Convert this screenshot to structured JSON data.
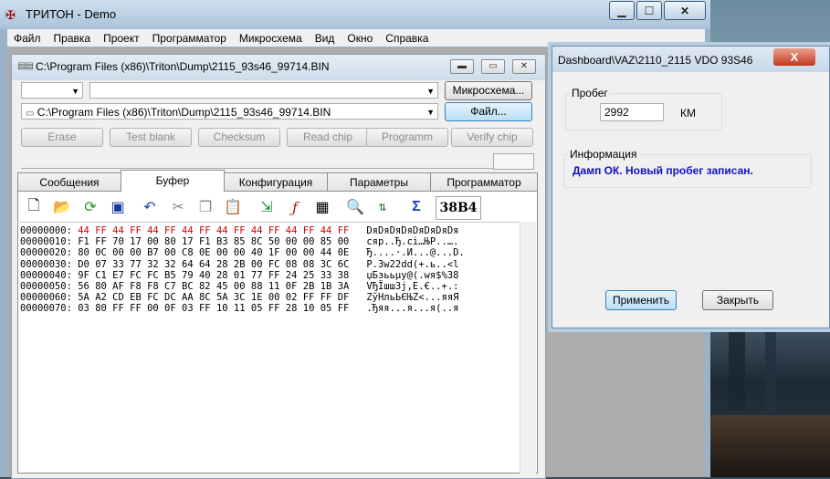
{
  "app": {
    "title": "ТРИТОН - Demo"
  },
  "menu": [
    "Файл",
    "Правка",
    "Проект",
    "Программатор",
    "Микросхема",
    "Вид",
    "Окно",
    "Справка"
  ],
  "child": {
    "title": "C:\\Program Files (x86)\\Triton\\Dump\\2115_93s46_99714.BIN",
    "combo_path": "C:\\Program Files (x86)\\Triton\\Dump\\2115_93s46_99714.BIN",
    "chip_button": "Микросхема...",
    "file_button": "Файл...",
    "actions": [
      "Erase",
      "Test blank",
      "Checksum",
      "Read chip",
      "Programm",
      "Verify chip"
    ],
    "tabs": [
      "Сообщения",
      "Буфер",
      "Конфигурация",
      "Параметры",
      "Программатор"
    ],
    "checksum": "38B4",
    "hex": [
      {
        "addr": "00000000:",
        "bytes": "44 FF 44 FF 44 FF 44 FF 44 FF 44 FF 44 FF 44 FF",
        "ascii": "DяDяDяDяDяDяDяDя",
        "red": true
      },
      {
        "addr": "00000010:",
        "bytes": "F1 FF 70 17 00 80 17 F1 B3 85 8C 50 00 00 85 00",
        "ascii": "сяp..Ђ.сі…ЊP..…."
      },
      {
        "addr": "00000020:",
        "bytes": "80 0C 00 00 B7 00 C8 0E 00 00 40 1F 00 00 44 0E",
        "ascii": "Ђ....·.И...@...D."
      },
      {
        "addr": "00000030:",
        "bytes": "D0 07 33 77 32 32 64 64 28 2B 00 FC 08 08 3C 6C",
        "ascii": "Р.3w22dd(+.ь..<l"
      },
      {
        "addr": "00000040:",
        "bytes": "9F C1 E7 FC FC B5 79 40 28 01 77 FF 24 25 33 38",
        "ascii": "џБзььµy@(.wя$%38"
      },
      {
        "addr": "00000050:",
        "bytes": "56 80 AF F8 F8 C7 BC 82 45 00 88 11 0F 2B 1B 3A",
        "ascii": "VЂЇшшЗј‚E.€..+.:"
      },
      {
        "addr": "00000060:",
        "bytes": "5A A2 CD EB FC DC AA 8C 5A 3C 1E 00 02 FF FF DF",
        "ascii": "ZўНльЬЄЊZ<...яяЯ"
      },
      {
        "addr": "00000070:",
        "bytes": "03 80 FF FF 00 0F 03 FF 10 11 05 FF 28 10 05 FF",
        "ascii": ".Ђяя...я...я(..я"
      }
    ]
  },
  "dialog": {
    "title": "Dashboard\\VAZ\\2110_2115 VDO 93S46",
    "close_label": "X",
    "mileage_legend": "Пробег",
    "mileage_value": "2992",
    "mileage_unit": "КМ",
    "info_legend": "Информация",
    "info_text": "Дамп ОК. Новый пробег записан.",
    "apply_button": "Применить",
    "close_button": "Закрыть"
  },
  "colors": {
    "info_text": "#1010c0",
    "hex_red": "#d40000"
  }
}
